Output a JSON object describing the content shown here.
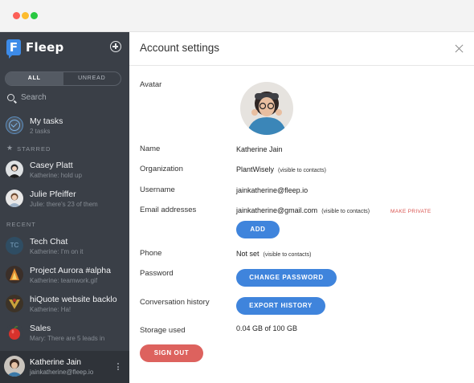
{
  "app": {
    "name": "Fleep"
  },
  "sidebar": {
    "filters": [
      "ALL",
      "UNREAD"
    ],
    "search_placeholder": "Search",
    "tasks": {
      "name": "My tasks",
      "sub": "2 tasks"
    },
    "starred_label": "STARRED",
    "recent_label": "RECENT",
    "starred": [
      {
        "name": "Casey Platt",
        "sub": "Katherine: hold up"
      },
      {
        "name": "Julie Pfeiffer",
        "sub": "Julie: there's 23 of them"
      }
    ],
    "recent": [
      {
        "name": "Tech Chat",
        "sub": "Katherine: I'm on it",
        "initials": "TC"
      },
      {
        "name": "Project Aurora #alpha",
        "sub": "Katherine: teamwork.gif"
      },
      {
        "name": "hiQuote website backlo",
        "sub": "Katherine: Ha!"
      },
      {
        "name": "Sales",
        "sub": "Mary: There are 5 leads in"
      }
    ],
    "user": {
      "name": "Katherine Jain",
      "email": "jainkatherine@fleep.io"
    }
  },
  "settings": {
    "title": "Account settings",
    "labels": {
      "avatar": "Avatar",
      "name": "Name",
      "organization": "Organization",
      "username": "Username",
      "email": "Email addresses",
      "phone": "Phone",
      "password": "Password",
      "history": "Conversation history",
      "storage": "Storage used"
    },
    "values": {
      "name": "Katherine Jain",
      "organization": "PlantWisely",
      "organization_note": "(visible to contacts)",
      "username": "jainkatherine@fleep.io",
      "email": "jainkatherine@gmail.com",
      "email_note": "(visible to contacts)",
      "make_private": "MAKE PRIVATE",
      "phone": "Not set",
      "phone_note": "(visible to contacts)",
      "storage": "0.04 GB of 100 GB"
    },
    "buttons": {
      "add": "ADD",
      "change_password": "CHANGE PASSWORD",
      "export_history": "EXPORT HISTORY",
      "sign_out": "SIGN OUT"
    }
  },
  "colors": {
    "sidebar_bg": "#3a3f47",
    "accent_blue": "#3f84dc",
    "sign_out_red": "#dd625e",
    "make_private_red": "#d9534f"
  }
}
